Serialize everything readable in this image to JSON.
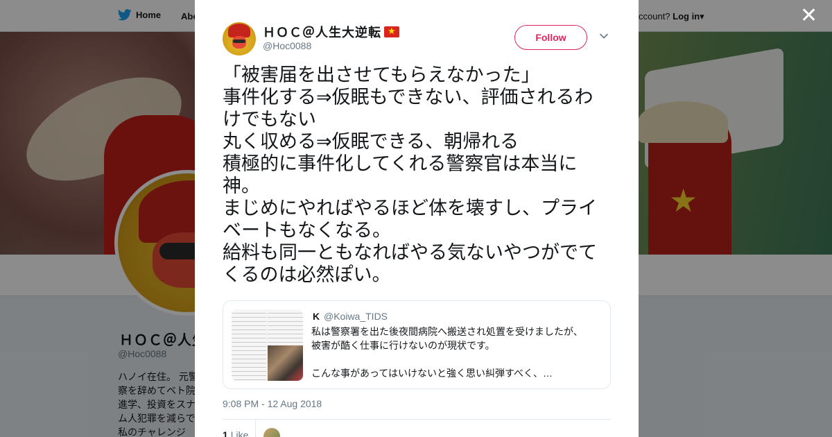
{
  "nav": {
    "home_label": "Home",
    "about_label": "About",
    "account_prompt": "ccount?",
    "login_label": "Log in"
  },
  "profile": {
    "name": "ＨＯＣ＠人生",
    "handle": "@Hoc0088",
    "bio": "ハノイ在住。 元警察を辞めてベト院進学、投資をスナム人犯罪を減らで私のチャレンジ"
  },
  "tweet": {
    "author_name": "ＨＯＣ＠人生大逆転",
    "author_handle": "@Hoc0088",
    "flag_icon": "vietnam-flag-icon",
    "follow_label": "Follow",
    "text": "「被害届を出させてもらえなかった」\n事件化する⇒仮眠もできない、評価されるわけでもない\n丸く収める⇒仮眠できる、朝帰れる\n積極的に事件化してくれる警察官は本当に神。\nまじめにやればやるほど体を壊すし、プライベートもなくなる。\n給料も同一ともなればやる気ないやつがでてくるのは必然ぽい。",
    "quote": {
      "author_initial": "K",
      "handle": "@Koiwa_TIDS",
      "text": "私は警察署を出た後夜間病院へ搬送され処置を受けましたが、\n被害が酷く仕事に行けないのが現状です。\n\nこんな事があってはいけないと強く思い糾弾すべく、…"
    },
    "timestamp": "9:08 PM - 12 Aug 2018",
    "likes_count": "1",
    "likes_label": "Like"
  },
  "colors": {
    "accent": "#e0245e",
    "twitter_blue": "#1da1f2",
    "text": "#14171a",
    "muted": "#657786"
  }
}
